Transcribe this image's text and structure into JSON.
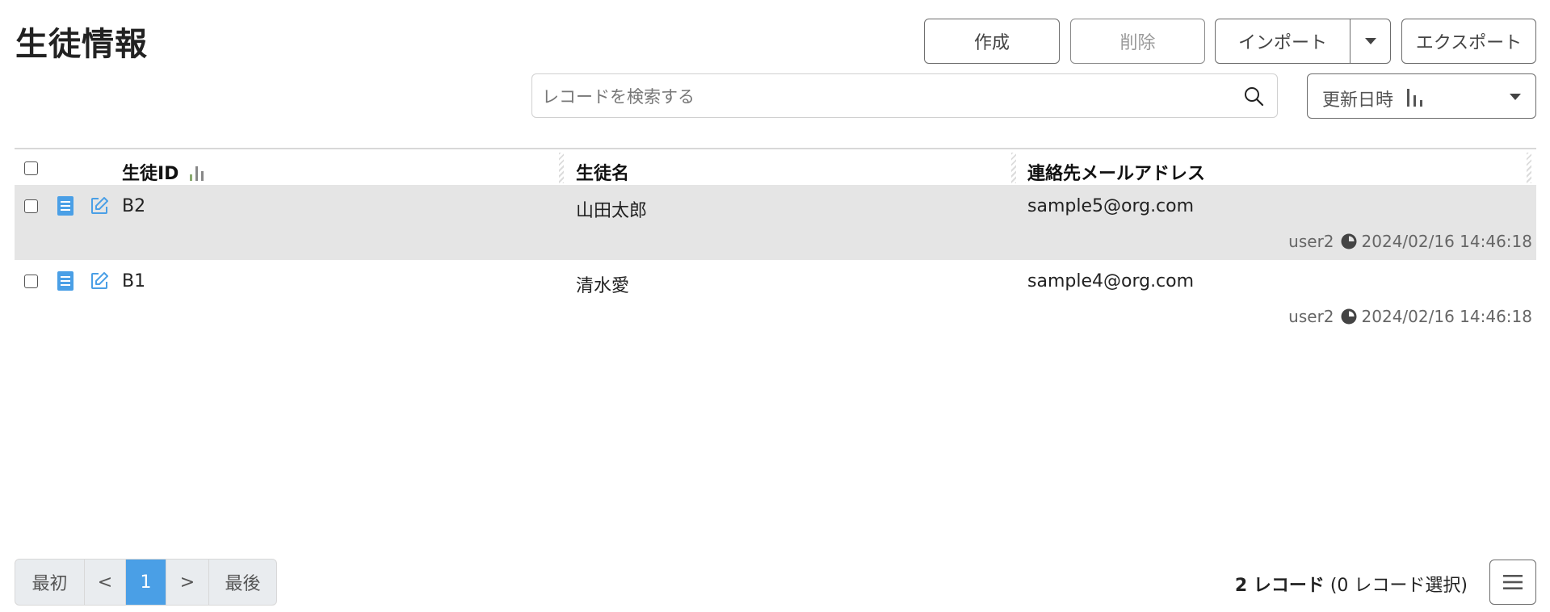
{
  "page": {
    "title": "生徒情報"
  },
  "toolbar": {
    "create_label": "作成",
    "delete_label": "削除",
    "import_label": "インポート",
    "export_label": "エクスポート"
  },
  "search": {
    "placeholder": "レコードを検索する",
    "value": ""
  },
  "sort": {
    "label": "更新日時"
  },
  "table": {
    "headers": {
      "id": "生徒ID",
      "name": "生徒名",
      "email": "連絡先メールアドレス"
    },
    "rows": [
      {
        "id": "B2",
        "name": "山田太郎",
        "email": "sample5@org.com",
        "user": "user2",
        "updated": "2024/02/16 14:46:18"
      },
      {
        "id": "B1",
        "name": "清水愛",
        "email": "sample4@org.com",
        "user": "user2",
        "updated": "2024/02/16 14:46:18"
      }
    ]
  },
  "pagination": {
    "first": "最初",
    "prev": "<",
    "current": "1",
    "next": ">",
    "last": "最後"
  },
  "footer": {
    "count_bold": "2 レコード",
    "count_rest": " (0 レコード選択)"
  },
  "colors": {
    "accent": "#4a9fe6",
    "row_stripe": "#e5e5e5",
    "icon_blue": "#4a9fe6"
  },
  "icons": [
    "search-icon",
    "sort-bars-icon",
    "chevron-down-icon",
    "document-icon",
    "edit-icon",
    "clock-icon",
    "hamburger-menu-icon"
  ]
}
